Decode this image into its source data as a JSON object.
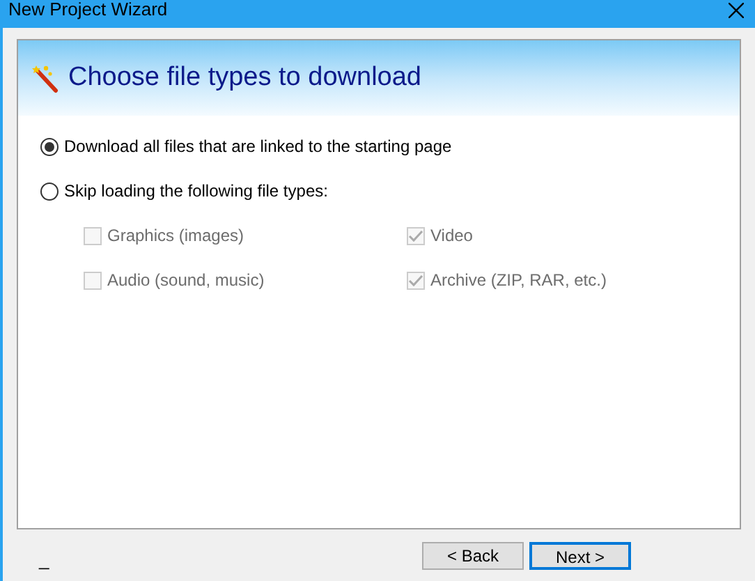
{
  "window": {
    "title": "New Project Wizard"
  },
  "header": {
    "title": "Choose file types to download"
  },
  "options": [
    {
      "label": "Download all files that are linked to the starting page",
      "selected": true
    },
    {
      "label": "Skip loading the following file types:",
      "selected": false
    }
  ],
  "file_types": [
    {
      "label": "Graphics (images)",
      "checked": false,
      "disabled": true
    },
    {
      "label": "Video",
      "checked": true,
      "disabled": true
    },
    {
      "label": "Audio (sound, music)",
      "checked": false,
      "disabled": true
    },
    {
      "label": "Archive (ZIP, RAR, etc.)",
      "checked": true,
      "disabled": true
    }
  ],
  "status_text": "_",
  "buttons": [
    {
      "label": "< Back",
      "kind": "back"
    },
    {
      "label": "Next >",
      "kind": "default"
    }
  ]
}
